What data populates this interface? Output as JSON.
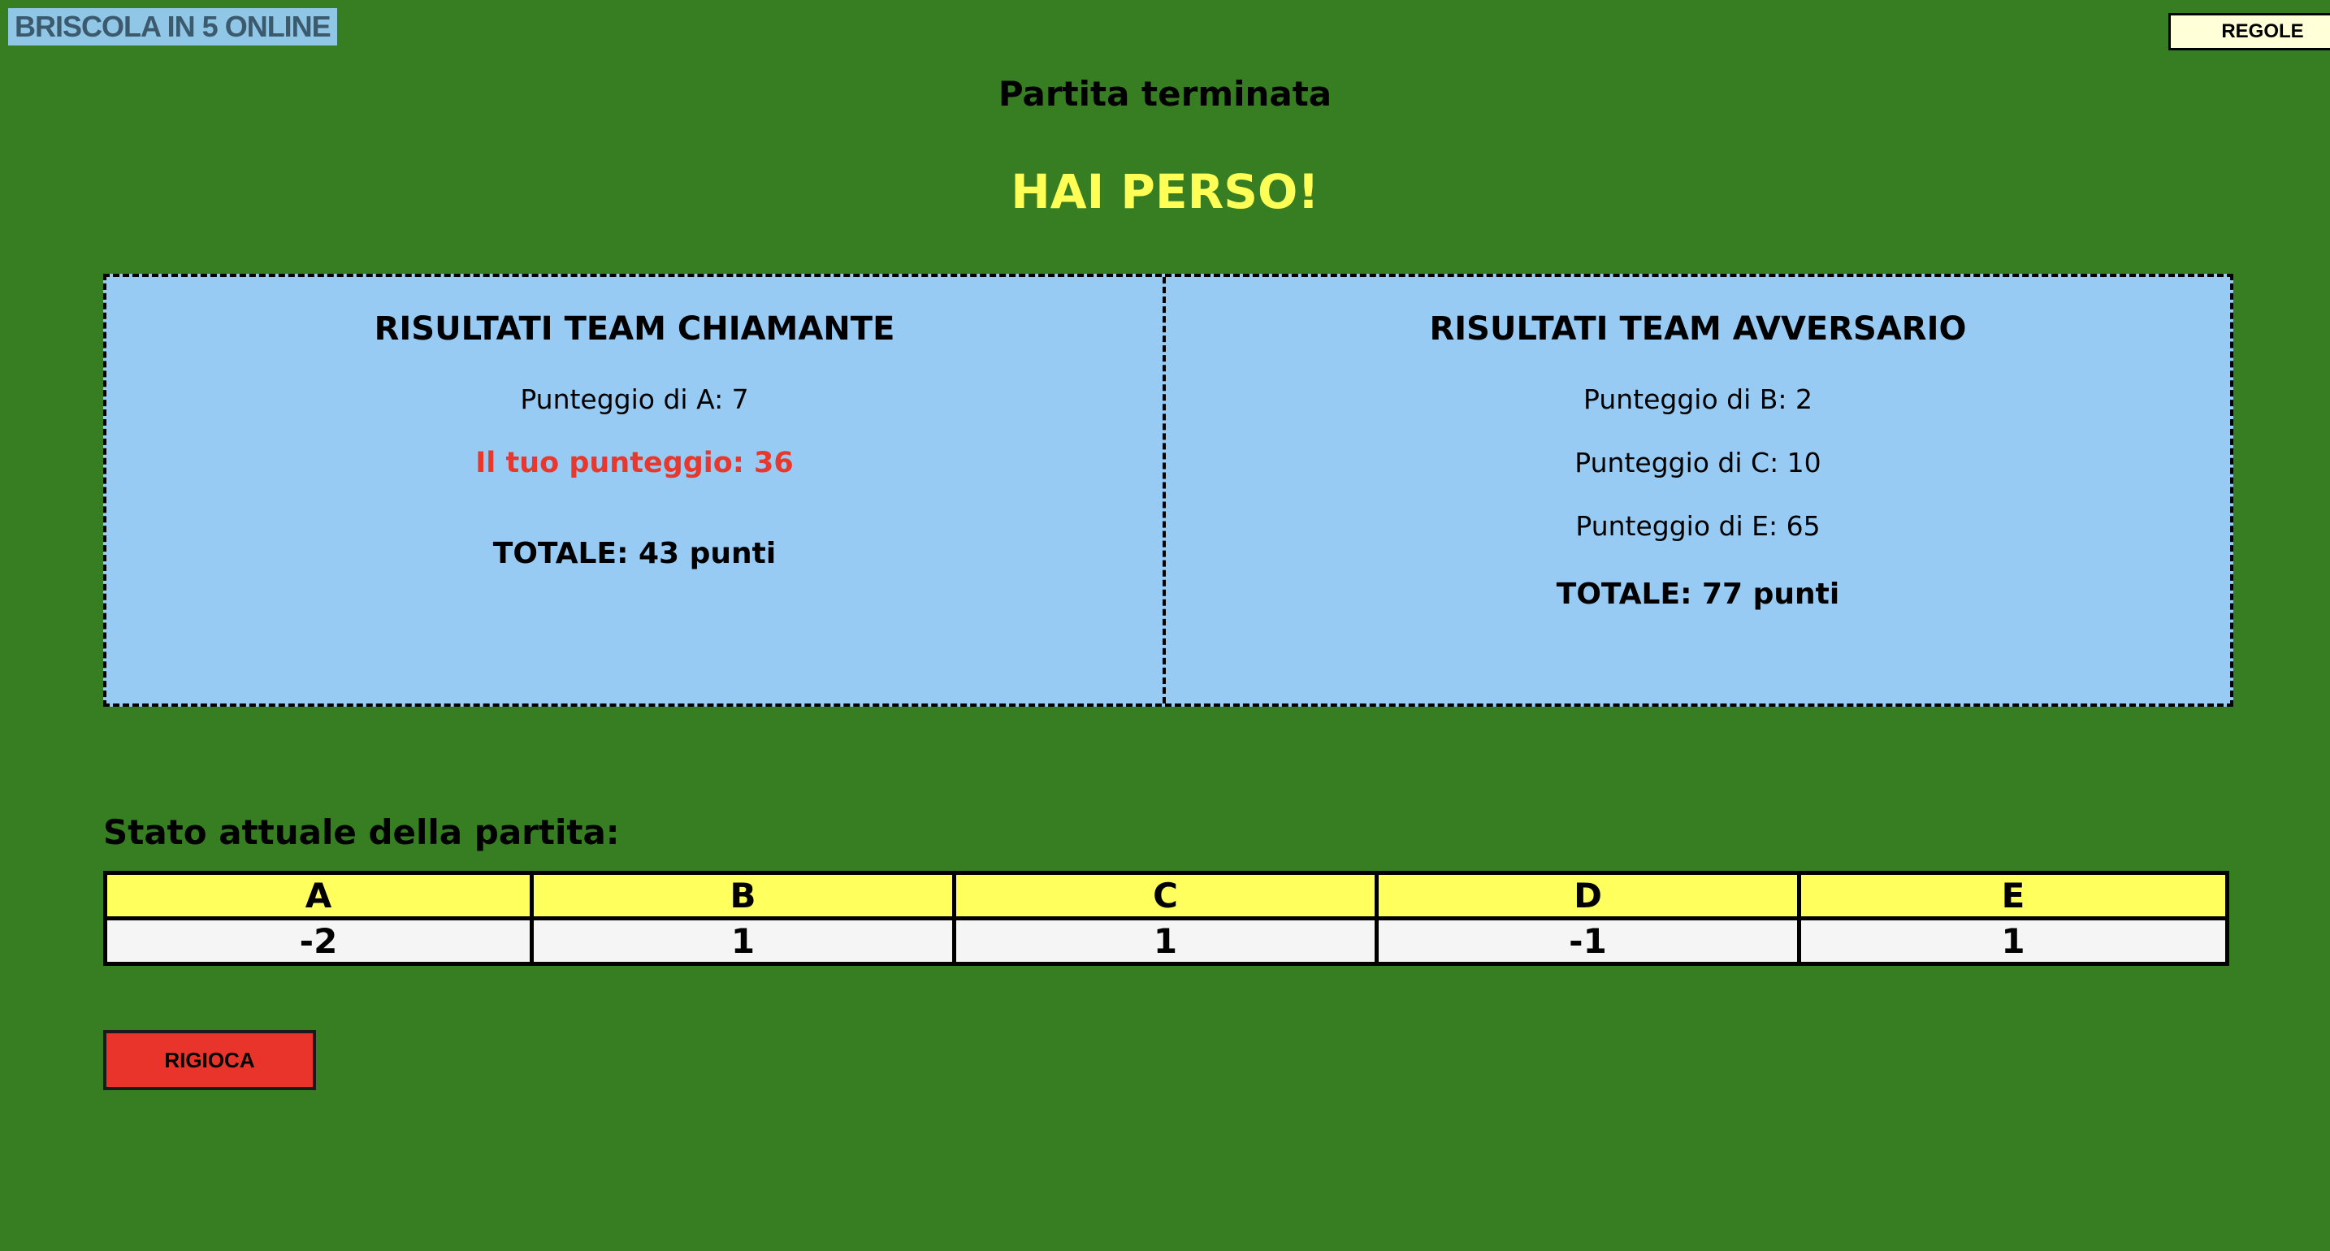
{
  "header": {
    "logo_text": "BRISCOLA IN 5 ONLINE",
    "rules_button": "REGOLE"
  },
  "status": {
    "title": "Partita terminata",
    "outcome": "HAI PERSO!"
  },
  "results": {
    "calling_team": {
      "heading": "RISULTATI TEAM CHIAMANTE",
      "scores": [
        "Punteggio di A: 7"
      ],
      "your_score": "Il tuo punteggio: 36",
      "total": "TOTALE: 43 punti"
    },
    "opponent_team": {
      "heading": "RISULTATI TEAM AVVERSARIO",
      "scores": [
        "Punteggio di B: 2",
        "Punteggio di C: 10",
        "Punteggio di E: 65"
      ],
      "total": "TOTALE: 77 punti"
    }
  },
  "game_state": {
    "label": "Stato attuale della partita:",
    "columns": [
      "A",
      "B",
      "C",
      "D",
      "E"
    ],
    "values": [
      "-2",
      "1",
      "1",
      "-1",
      "1"
    ]
  },
  "actions": {
    "replay_button": "RIGIOCA"
  },
  "colors": {
    "background": "#377e22",
    "outcome": "#ffff55",
    "panel": "#97cbf4",
    "highlight": "#e8372c",
    "table_header": "#ffff5e",
    "replay_button": "#e8342a"
  }
}
